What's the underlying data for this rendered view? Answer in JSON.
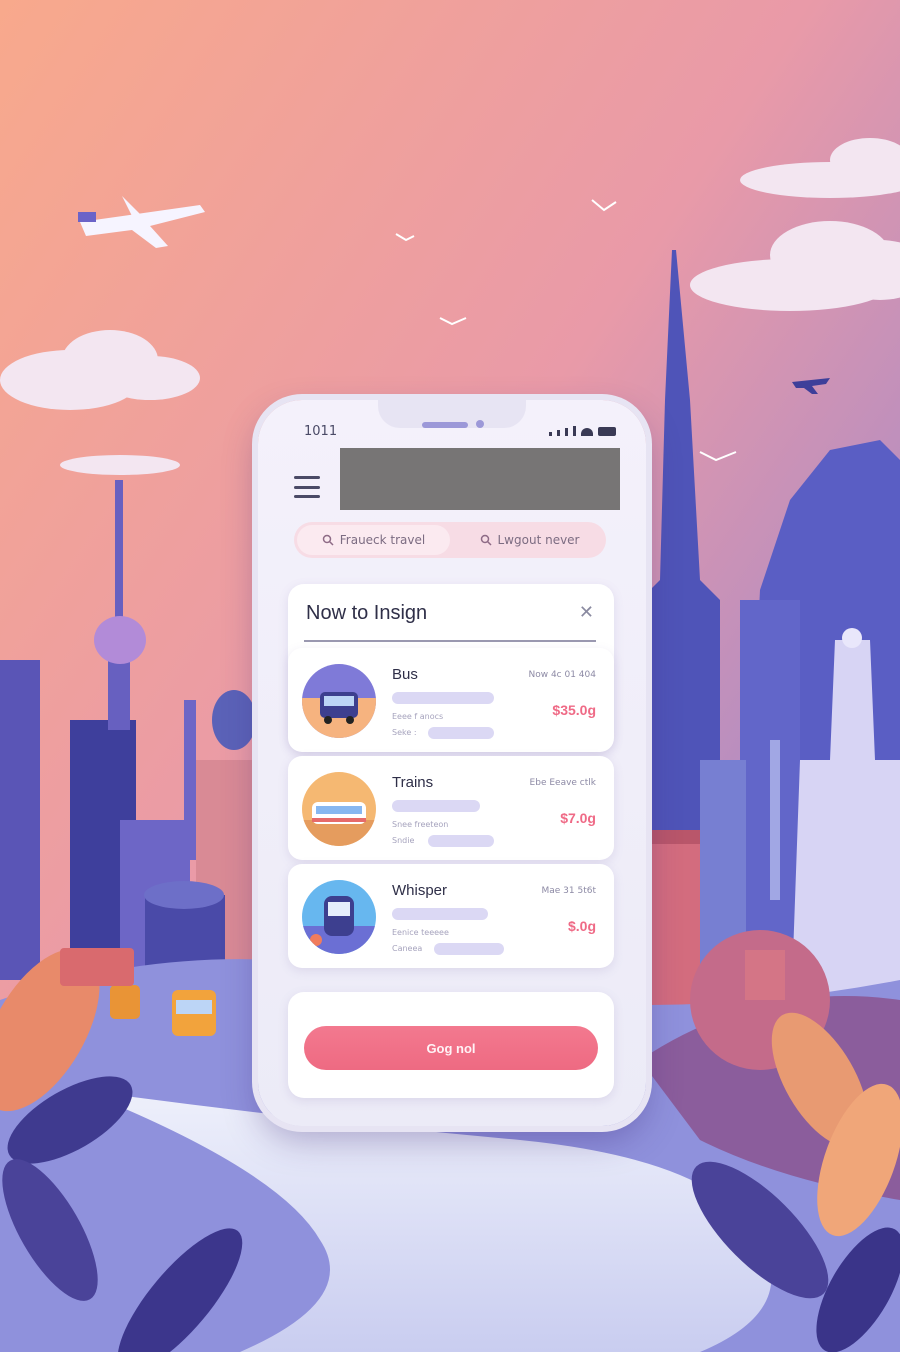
{
  "status_bar": {
    "time": "1011"
  },
  "tabs": [
    {
      "label": "Fraueck travel",
      "icon": "search-icon",
      "active": true
    },
    {
      "label": "Lwgout never",
      "icon": "search-icon",
      "active": false
    }
  ],
  "panel": {
    "title": "Now to Insign",
    "close_icon": "close-icon"
  },
  "results": [
    {
      "name": "Bus",
      "meta": "Now 4c 01 404",
      "price": "$35.0g",
      "sub1": "Eeee f anocs",
      "sub2": "Seke :"
    },
    {
      "name": "Trains",
      "meta": "Ebe Eeave ctlk",
      "price": "$7.0g",
      "sub1": "Snee freeteon",
      "sub2": "Sndie"
    },
    {
      "name": "Whisper",
      "meta": "Mae 31 5t6t",
      "price": "$.0g",
      "sub1": "Eenice teeeee",
      "sub2": "Caneea"
    }
  ],
  "cta": {
    "label": "Gog nol"
  },
  "colors": {
    "accent": "#ee6a82",
    "sky_top": "#f6a98f",
    "sky_bottom": "#8077d6"
  }
}
